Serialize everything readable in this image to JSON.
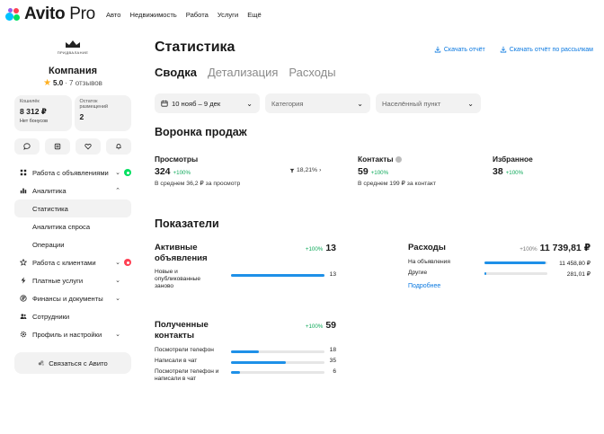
{
  "header": {
    "logo_name": "Avito",
    "logo_suffix": "Pro",
    "nav": [
      "Авто",
      "Недвижимость",
      "Работа",
      "Услуги",
      "Ещё"
    ]
  },
  "sidebar": {
    "company_logo_caption": "ПРИДВАЛАНИЕ",
    "company_name": "Компания",
    "rating_value": "5.0",
    "rating_reviews": "· 7 отзывов",
    "wallet": {
      "label": "Кошелёк",
      "value": "8 312 ₽",
      "sub": "Нет бонусов"
    },
    "placements": {
      "label": "Остаток размещений",
      "value": "2"
    },
    "quick_icons": [
      "chat-icon",
      "wallet-icon",
      "heart-icon",
      "bell-icon"
    ],
    "menu": [
      {
        "label": "Работа с объявлениями",
        "icon": "listing-icon",
        "chevron": "⌄",
        "dot": "#04e061"
      },
      {
        "label": "Аналитика",
        "icon": "chart-icon",
        "chevron": "⌃"
      },
      {
        "label": "Статистика",
        "sub": true,
        "active": true
      },
      {
        "label": "Аналитика спроса",
        "sub": true
      },
      {
        "label": "Операции",
        "sub": true
      },
      {
        "label": "Работа с клиентами",
        "icon": "star-icon",
        "chevron": "⌄",
        "dot": "#ff4053"
      },
      {
        "label": "Платные услуги",
        "icon": "bolt-icon",
        "chevron": "⌄"
      },
      {
        "label": "Финансы и документы",
        "icon": "finance-icon",
        "chevron": "⌄"
      },
      {
        "label": "Сотрудники",
        "icon": "people-icon"
      },
      {
        "label": "Профиль и настройки",
        "icon": "gear-icon",
        "chevron": "⌄"
      }
    ],
    "contact_button": "Связаться с Авито"
  },
  "main": {
    "title": "Статистика",
    "downloads": [
      "Скачать отчёт",
      "Скачать отчёт по рассылкам"
    ],
    "tabs": [
      {
        "label": "Сводка",
        "active": true
      },
      {
        "label": "Детализация"
      },
      {
        "label": "Расходы"
      }
    ],
    "filters": {
      "date": "10 нояб – 9 дек",
      "category_placeholder": "Категория",
      "city_placeholder": "Населённый пункт"
    },
    "funnel": {
      "title": "Воронка продаж",
      "views": {
        "label": "Просмотры",
        "value": "324",
        "delta": "+100%",
        "sub": "В среднем 36,2 ₽ за просмотр"
      },
      "conversion": "18,21%",
      "contacts": {
        "label": "Контакты",
        "value": "59",
        "delta": "+100%",
        "sub": "В среднем 199 ₽ за контакт"
      },
      "favorites": {
        "label": "Избранное",
        "value": "38",
        "delta": "+100%"
      }
    },
    "indicators": {
      "title": "Показатели",
      "active": {
        "label": "Активные объявления",
        "delta": "+100%",
        "value": "13",
        "rows": [
          {
            "label": "Новые и опубликованные заново",
            "value": "13",
            "fraction": 1.0
          }
        ]
      },
      "expenses": {
        "label": "Расходы",
        "delta": "+100%",
        "value": "11 739,81 ₽",
        "rows": [
          {
            "label": "На объявления",
            "value": "11 458,80 ₽",
            "fraction": 0.97
          },
          {
            "label": "Другие",
            "value": "281,01 ₽",
            "fraction": 0.03
          }
        ],
        "more_link": "Подробнее"
      },
      "received_contacts": {
        "label": "Полученные контакты",
        "delta": "+100%",
        "value": "59",
        "rows": [
          {
            "label": "Посмотрели телефон",
            "value": "18",
            "fraction": 0.3
          },
          {
            "label": "Написали в чат",
            "value": "35",
            "fraction": 0.59
          },
          {
            "label": "Посмотрели телефон и написали в чат",
            "value": "6",
            "fraction": 0.1
          }
        ]
      }
    }
  },
  "colors": {
    "accent_blue": "#0a78e0",
    "bar_blue": "#1e90e8",
    "delta_green": "#0ea95a",
    "logo_star": "#ffb021"
  }
}
